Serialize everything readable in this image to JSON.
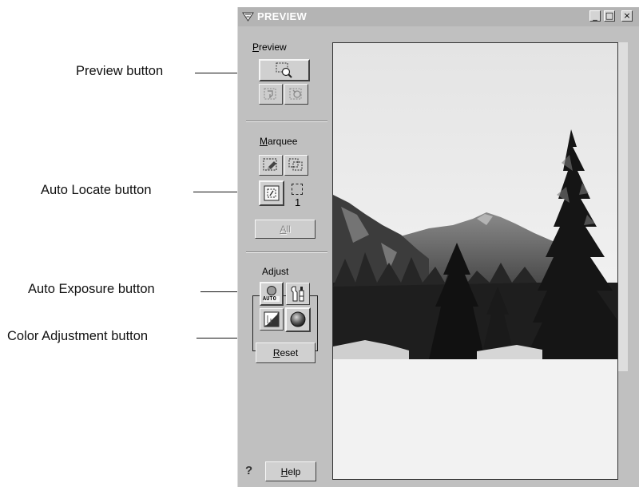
{
  "callouts": {
    "preview": "Preview button",
    "auto_locate": "Auto Locate button",
    "auto_exposure": "Auto Exposure button",
    "color_adjustment": "Color Adjustment button"
  },
  "window": {
    "title": "PREVIEW",
    "minimize_glyph": "_",
    "maximize_glyph": "□",
    "close_glyph": "×"
  },
  "panel": {
    "preview_label": "Preview",
    "preview_label_mnemonic": "P",
    "marquee_label": "Marquee",
    "marquee_label_mnemonic": "M",
    "marquee_count": "1",
    "all_label": "All",
    "all_label_mnemonic": "A",
    "adjust_label": "Adjust",
    "adjust_label_mnemonic": "j",
    "auto_text": "AUTO",
    "reset_label": "Reset",
    "reset_label_mnemonic": "R",
    "help_label": "Help",
    "help_label_mnemonic": "H",
    "help_glyph": "?"
  },
  "colors": {
    "window_bg": "#c0c0c0",
    "titlebar": "#b4b4b4",
    "preview_bg": "#f2f2f2"
  }
}
